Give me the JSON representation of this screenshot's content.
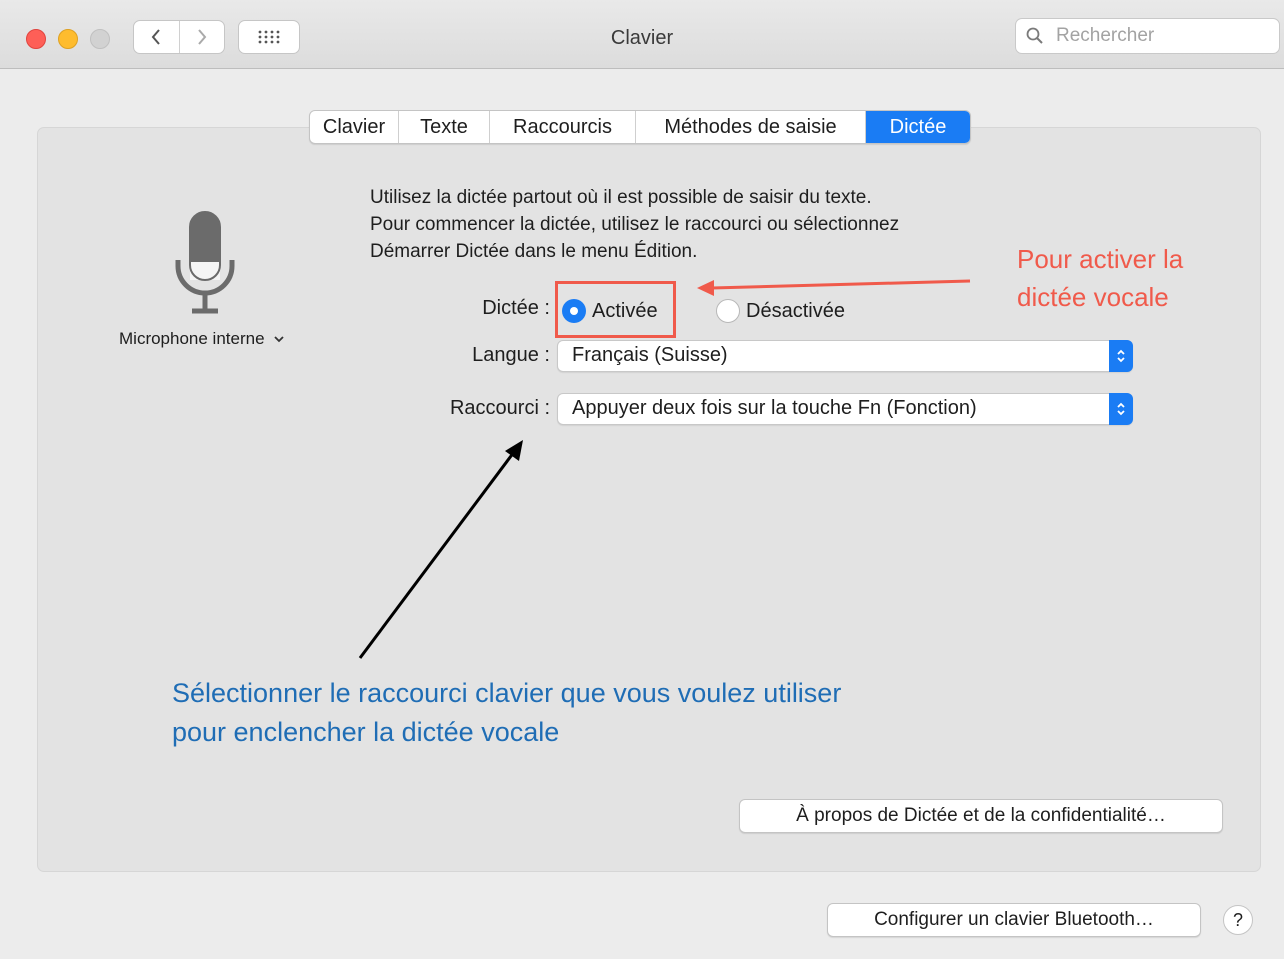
{
  "window": {
    "title": "Clavier",
    "search_placeholder": "Rechercher"
  },
  "tabs": [
    {
      "label": "Clavier",
      "active": false
    },
    {
      "label": "Texte",
      "active": false
    },
    {
      "label": "Raccourcis",
      "active": false
    },
    {
      "label": "Méthodes de saisie",
      "active": false
    },
    {
      "label": "Dictée",
      "active": true
    }
  ],
  "dictation": {
    "description": [
      "Utilisez la dictée partout où il est possible de saisir du texte.",
      "Pour commencer la dictée, utilisez le raccourci ou sélectionnez",
      "Démarrer Dictée dans le menu Édition."
    ],
    "microphone_label": "Microphone interne",
    "dictation_label": "Dictée :",
    "option_on": "Activée",
    "option_off": "Désactivée",
    "selected": "Activée",
    "language_label": "Langue :",
    "language_value": "Français (Suisse)",
    "shortcut_label": "Raccourci :",
    "shortcut_value": "Appuyer deux fois sur la touche Fn (Fonction)",
    "about_button": "À propos de Dictée et de la confidentialité…"
  },
  "footer": {
    "bluetooth_button": "Configurer un clavier Bluetooth…",
    "help_label": "?"
  },
  "annotations": {
    "red_note_lines": [
      "Pour activer la",
      "dictée vocale"
    ],
    "blue_note_lines": [
      "Sélectionner le raccourci clavier que vous voulez utiliser",
      "pour enclencher la dictée vocale"
    ]
  },
  "colors": {
    "accent": "#1a7cf4",
    "annotation_red": "#f05a4b",
    "annotation_blue": "#1f6db5"
  }
}
